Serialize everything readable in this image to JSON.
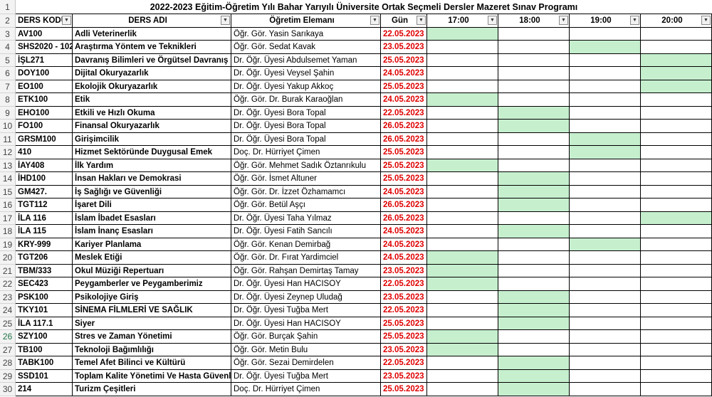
{
  "sheet": {
    "title": "2022-2023 Eğitim-Öğretim Yılı Bahar Yarıyılı Üniversite Ortak Seçmeli Dersler Mazeret Sınav Programı",
    "row_numbers": [
      "1",
      "2",
      "3",
      "4",
      "5",
      "6",
      "7",
      "8",
      "9",
      "10",
      "11",
      "12",
      "13",
      "14",
      "15",
      "16",
      "17",
      "18",
      "19",
      "20",
      "21",
      "22",
      "23",
      "24",
      "25",
      "26",
      "27",
      "28",
      "29",
      "30"
    ],
    "selected_row": "26",
    "headers": [
      "DERS KODU",
      "DERS ADI",
      "Öğretim Elemanı",
      "Gün",
      "17:00",
      "18:00",
      "19:00",
      "20:00"
    ],
    "filter_icon": "dropdown-filter-icon",
    "colors": {
      "highlight": "#c6efce",
      "date_text": "#e00000",
      "selected_row_header": "#217346"
    },
    "rows": [
      {
        "code": "AV100",
        "course": "Adli Veterinerlik",
        "instructor": "Öğr. Gör. Yasin Sarıkaya",
        "date": "22.05.2023",
        "slot": "17:00"
      },
      {
        "code": "SHS2020 - 102",
        "course": "Araştırma Yöntem ve Teknikleri",
        "instructor": "Öğr. Gör. Sedat Kavak",
        "date": "23.05.2023",
        "slot": "19:00"
      },
      {
        "code": "İŞL271",
        "course": "Davranış Bilimleri ve Örgütsel Davranış",
        "instructor": "Dr. Öğr. Üyesi Abdulsemet Yaman",
        "date": "25.05.2023",
        "slot": "20:00"
      },
      {
        "code": "DOY100",
        "course": "Dijital Okuryazarlık",
        "instructor": "Dr. Öğr. Üyesi Veysel Şahin",
        "date": "24.05.2023",
        "slot": "20:00"
      },
      {
        "code": "EO100",
        "course": "Ekolojik Okuryazarlık",
        "instructor": "Dr. Öğr. Üyesi Yakup Akkoç",
        "date": "25.05.2023",
        "slot": "20:00"
      },
      {
        "code": "ETK100",
        "course": "Etik",
        "instructor": "Öğr. Gör. Dr. Burak Karaoğlan",
        "date": "24.05.2023",
        "slot": "17:00"
      },
      {
        "code": "EHO100",
        "course": "Etkili ve Hızlı Okuma",
        "instructor": "Dr. Öğr. Üyesi Bora Topal",
        "date": "22.05.2023",
        "slot": "18:00"
      },
      {
        "code": "FO100",
        "course": "Finansal Okuryazarlık",
        "instructor": "Dr. Öğr. Üyesi Bora Topal",
        "date": "26.05.2023",
        "slot": "18:00"
      },
      {
        "code": "GRSM100",
        "course": "Girişimcilik",
        "instructor": "Dr. Öğr. Üyesi Bora Topal",
        "date": "26.05.2023",
        "slot": "19:00"
      },
      {
        "code": "410",
        "course": "Hizmet Sektöründe Duygusal Emek",
        "instructor": "Doç. Dr. Hürriyet Çimen",
        "date": "25.05.2023",
        "slot": "19:00"
      },
      {
        "code": "İAY408",
        "course": "İlk Yardım",
        "instructor": "Öğr. Gör. Mehmet Sadık Öztanrıkulu",
        "date": "25.05.2023",
        "slot": "17:00"
      },
      {
        "code": "İHD100",
        "course": "İnsan Hakları ve Demokrasi",
        "instructor": "Öğr. Gör. İsmet Altuner",
        "date": "25.05.2023",
        "slot": "18:00"
      },
      {
        "code": "GM427.",
        "course": "İş Sağlığı ve Güvenliği",
        "instructor": "Öğr. Gör. Dr. İzzet Özhamamcı",
        "date": "24.05.2023",
        "slot": "18:00"
      },
      {
        "code": "TGT112",
        "course": "İşaret Dili",
        "instructor": "Öğr. Gör. Betül Aşçı",
        "date": "26.05.2023",
        "slot": "18:00"
      },
      {
        "code": "İLA 116",
        "course": "İslam İbadet Esasları",
        "instructor": "Dr. Öğr. Üyesi Taha Yılmaz",
        "date": "26.05.2023",
        "slot": "20:00"
      },
      {
        "code": "İLA 115",
        "course": "İslam İnanç Esasları",
        "instructor": "Dr. Öğr. Üyesi Fatih Sancılı",
        "date": "24.05.2023",
        "slot": "18:00"
      },
      {
        "code": "KRY-999",
        "course": "Kariyer Planlama",
        "instructor": "Öğr. Gör. Kenan Demirbağ",
        "date": "24.05.2023",
        "slot": "19:00"
      },
      {
        "code": "TGT206",
        "course": "Meslek Etiği",
        "instructor": "Öğr. Gör. Dr. Fırat Yardimciel",
        "date": "24.05.2023",
        "slot": "17:00"
      },
      {
        "code": "TBM/333",
        "course": "Okul Müziği Repertuarı",
        "instructor": "Öğr. Gör. Rahşan Demirtaş Tamay",
        "date": "23.05.2023",
        "slot": "17:00"
      },
      {
        "code": "SEC423",
        "course": "Peygamberler ve Peygamberimiz",
        "instructor": "Dr. Öğr. Üyesi Han HACISOY",
        "date": "22.05.2023",
        "slot": "17:00"
      },
      {
        "code": "PSK100",
        "course": "Psikolojiye Giriş",
        "instructor": "Dr. Öğr. Üyesi Zeynep Uludağ",
        "date": "23.05.2023",
        "slot": "18:00"
      },
      {
        "code": "TKY101",
        "course": "SİNEMA FİLMLERİ VE SAĞLIK",
        "instructor": "Dr. Öğr. Üyesi Tuğba Mert",
        "date": "22.05.2023",
        "slot": "18:00"
      },
      {
        "code": "İLA 117.1",
        "course": "Siyer",
        "instructor": "Dr. Öğr. Üyesi Han HACISOY",
        "date": "25.05.2023",
        "slot": "18:00"
      },
      {
        "code": "SZY100",
        "course": "Stres ve Zaman Yönetimi",
        "instructor": "Öğr. Gör. Burçak Şahin",
        "date": "25.05.2023",
        "slot": "17:00"
      },
      {
        "code": "TB100",
        "course": "Teknoloji Bağımlılığı",
        "instructor": "Öğr. Gör. Metin Bulu",
        "date": "23.05.2023",
        "slot": "17:00"
      },
      {
        "code": "TABK100",
        "course": "Temel Afet Bilinci ve Kültürü",
        "instructor": "Öğr. Gör. Sezai Demirdelen",
        "date": "22.05.2023",
        "slot": "18:00"
      },
      {
        "code": "SSD101",
        "course": "Toplam Kalite Yönetimi Ve Hasta Güvenliği",
        "instructor": "Dr. Öğr. Üyesi Tuğba Mert",
        "date": "23.05.2023",
        "slot": "18:00"
      },
      {
        "code": "214",
        "course": "Turizm Çeşitleri",
        "instructor": "Doç. Dr. Hürriyet Çimen",
        "date": "25.05.2023",
        "slot": "18:00"
      }
    ]
  }
}
